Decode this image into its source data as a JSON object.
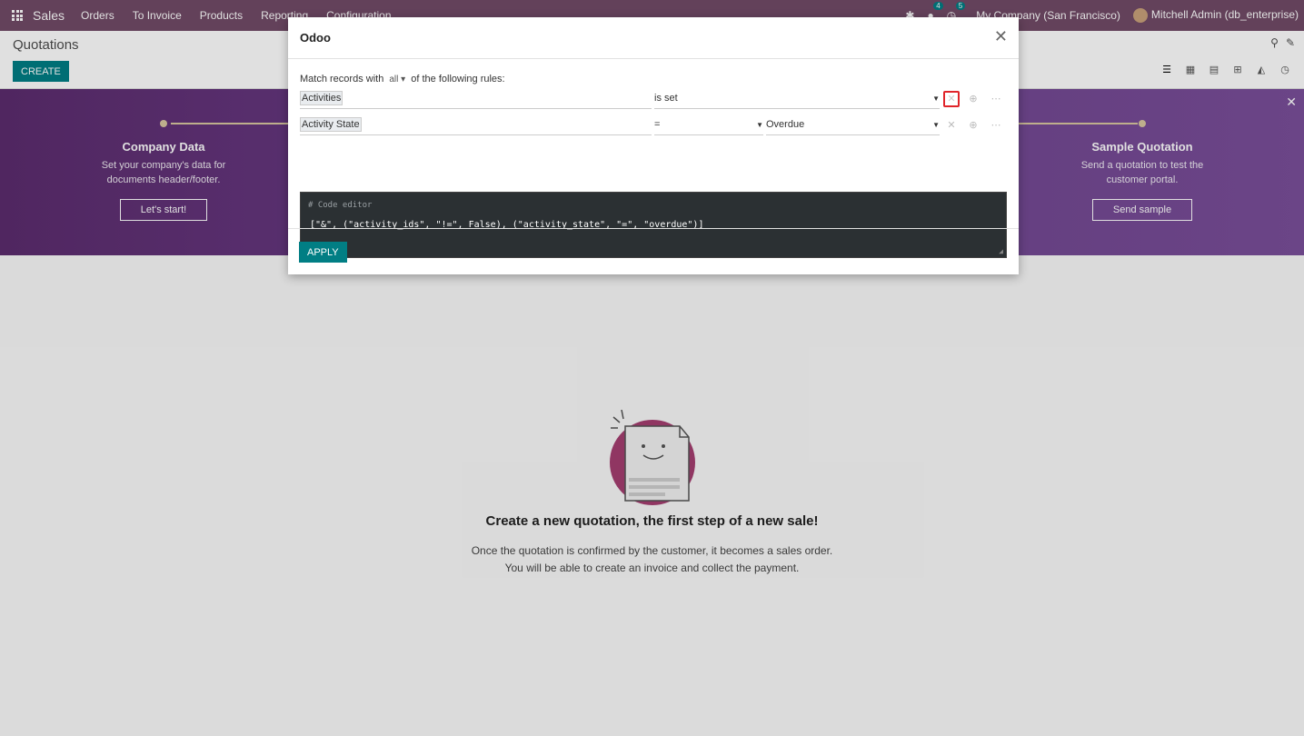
{
  "navbar": {
    "brand": "Sales",
    "menu": [
      "Orders",
      "To Invoice",
      "Products",
      "Reporting",
      "Configuration"
    ],
    "messages_count": "4",
    "activities_count": "5",
    "company": "My Company (San Francisco)",
    "user": "Mitchell Admin (db_enterprise)"
  },
  "control": {
    "breadcrumb": "Quotations",
    "create_label": "CREATE"
  },
  "banner": {
    "step_left": {
      "title": "Company Data",
      "desc": "Set your company's data for documents header/footer.",
      "button": "Let's start!"
    },
    "step_right": {
      "title": "Sample Quotation",
      "desc": "Send a quotation to test the customer portal.",
      "button": "Send sample"
    }
  },
  "empty": {
    "title": "Create a new quotation, the first step of a new sale!",
    "line1": "Once the quotation is confirmed by the customer, it becomes a sales order.",
    "line2": "You will be able to create an invoice and collect the payment."
  },
  "modal": {
    "title": "Odoo",
    "match_prefix": "Match records with",
    "match_value": "all",
    "match_suffix": "of the following rules:",
    "rules": [
      {
        "field": "Activities",
        "operator": "is set",
        "value": ""
      },
      {
        "field": "Activity State",
        "operator": "=",
        "value": "Overdue"
      }
    ],
    "code_comment": "# Code editor",
    "code": "[\"&\", (\"activity_ids\", \"!=\", False), (\"activity_state\", \"=\", \"overdue\")]",
    "apply_label": "APPLY"
  },
  "colors": {
    "navbar": "#714b67",
    "primary": "#017e84",
    "highlight": "#e0242a"
  }
}
